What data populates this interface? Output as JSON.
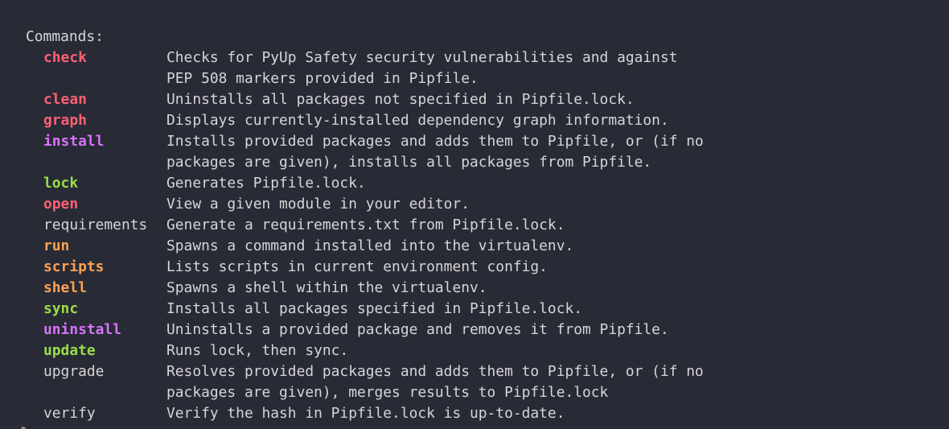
{
  "terminal": {
    "heading": "Commands:",
    "colors": {
      "background": "#282a36",
      "text": "#d6d6d6",
      "red": "#ff6073",
      "magenta": "#d773f7",
      "green": "#9bdd4a",
      "orange": "#ffa14f"
    },
    "commands": [
      {
        "name": "check",
        "color": "red",
        "lines": [
          "Checks for PyUp Safety security vulnerabilities and against",
          "PEP 508 markers provided in Pipfile."
        ]
      },
      {
        "name": "clean",
        "color": "red",
        "lines": [
          "Uninstalls all packages not specified in Pipfile.lock."
        ]
      },
      {
        "name": "graph",
        "color": "red",
        "lines": [
          "Displays currently-installed dependency graph information."
        ]
      },
      {
        "name": "install",
        "color": "magenta",
        "lines": [
          "Installs provided packages and adds them to Pipfile, or (if no",
          "packages are given), installs all packages from Pipfile."
        ]
      },
      {
        "name": "lock",
        "color": "green",
        "lines": [
          "Generates Pipfile.lock."
        ]
      },
      {
        "name": "open",
        "color": "red",
        "lines": [
          "View a given module in your editor."
        ]
      },
      {
        "name": "requirements",
        "color": "plain",
        "lines": [
          "Generate a requirements.txt from Pipfile.lock."
        ]
      },
      {
        "name": "run",
        "color": "orange",
        "lines": [
          "Spawns a command installed into the virtualenv."
        ]
      },
      {
        "name": "scripts",
        "color": "orange",
        "lines": [
          "Lists scripts in current environment config."
        ]
      },
      {
        "name": "shell",
        "color": "orange",
        "lines": [
          "Spawns a shell within the virtualenv."
        ]
      },
      {
        "name": "sync",
        "color": "green",
        "lines": [
          "Installs all packages specified in Pipfile.lock."
        ]
      },
      {
        "name": "uninstall",
        "color": "magenta",
        "lines": [
          "Uninstalls a provided package and removes it from Pipfile."
        ]
      },
      {
        "name": "update",
        "color": "green",
        "lines": [
          "Runs lock, then sync."
        ]
      },
      {
        "name": "upgrade",
        "color": "plain",
        "lines": [
          "Resolves provided packages and adds them to Pipfile, or (if no",
          "packages are given), merges results to Pipfile.lock"
        ]
      },
      {
        "name": "verify",
        "color": "plain",
        "lines": [
          "Verify the hash in Pipfile.lock is up-to-date."
        ]
      }
    ]
  }
}
